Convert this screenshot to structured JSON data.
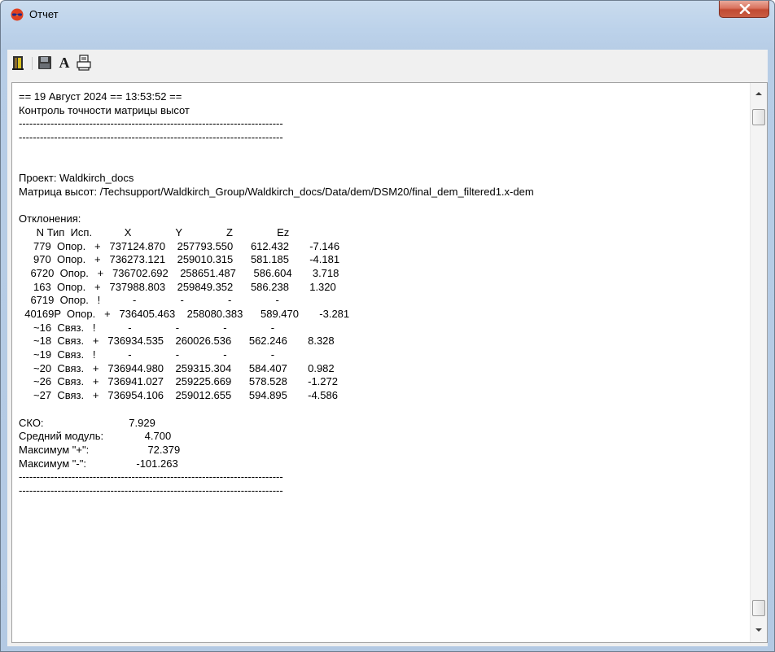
{
  "window": {
    "title": "Отчет",
    "close_icon": "close-icon"
  },
  "toolbar": {
    "buttons": [
      {
        "name": "exit-button",
        "icon": "exit-icon"
      },
      {
        "name": "save-button",
        "icon": "floppy-icon"
      },
      {
        "name": "font-button",
        "icon": "font-icon",
        "glyph": "A"
      },
      {
        "name": "print-button",
        "icon": "printer-icon"
      }
    ]
  },
  "report": {
    "lines": [
      "== 19 Август 2024 == 13:53:52 ==",
      "Контроль точности матрицы высот",
      "---------------------------------------------------------------------------",
      "---------------------------------------------------------------------------",
      "",
      "",
      "Проект: Waldkirch_docs",
      "Матрица высот: /Techsupport/Waldkirch_Group/Waldkirch_docs/Data/dem/DSM20/final_dem_filtered1.x-dem",
      "",
      "Отклонения:",
      "      N Тип  Исп.           X               Y               Z               Ez",
      "     779  Опор.   +   737124.870    257793.550      612.432       -7.146",
      "     970  Опор.   +   736273.121    259010.315      581.185       -4.181",
      "    6720  Опор.   +   736702.692    258651.487      586.604       3.718",
      "     163  Опор.   +   737988.803    259849.352      586.238       1.320",
      "    6719  Опор.   !           -               -               -               -",
      "  40169P  Опор.   +   736405.463    258080.383      589.470       -3.281",
      "     ~16  Связ.   !           -               -               -               -",
      "     ~18  Связ.   +   736934.535    260026.536      562.246       8.328",
      "     ~19  Связ.   !           -               -               -               -",
      "     ~20  Связ.   +   736944.980    259315.304      584.407       0.982",
      "     ~26  Связ.   +   736941.027    259225.669      578.528       -1.272",
      "     ~27  Связ.   +   736954.106    259012.655      594.895       -4.586",
      "",
      "СКО:                             7.929",
      "Средний модуль:              4.700",
      "Максимум \"+\":                    72.379",
      "Максимум \"-\":                 -101.263",
      "---------------------------------------------------------------------------",
      "---------------------------------------------------------------------------"
    ]
  },
  "scrollbar": {
    "up_icon": "scroll-up-arrow-icon",
    "down_icon": "scroll-down-arrow-icon"
  }
}
